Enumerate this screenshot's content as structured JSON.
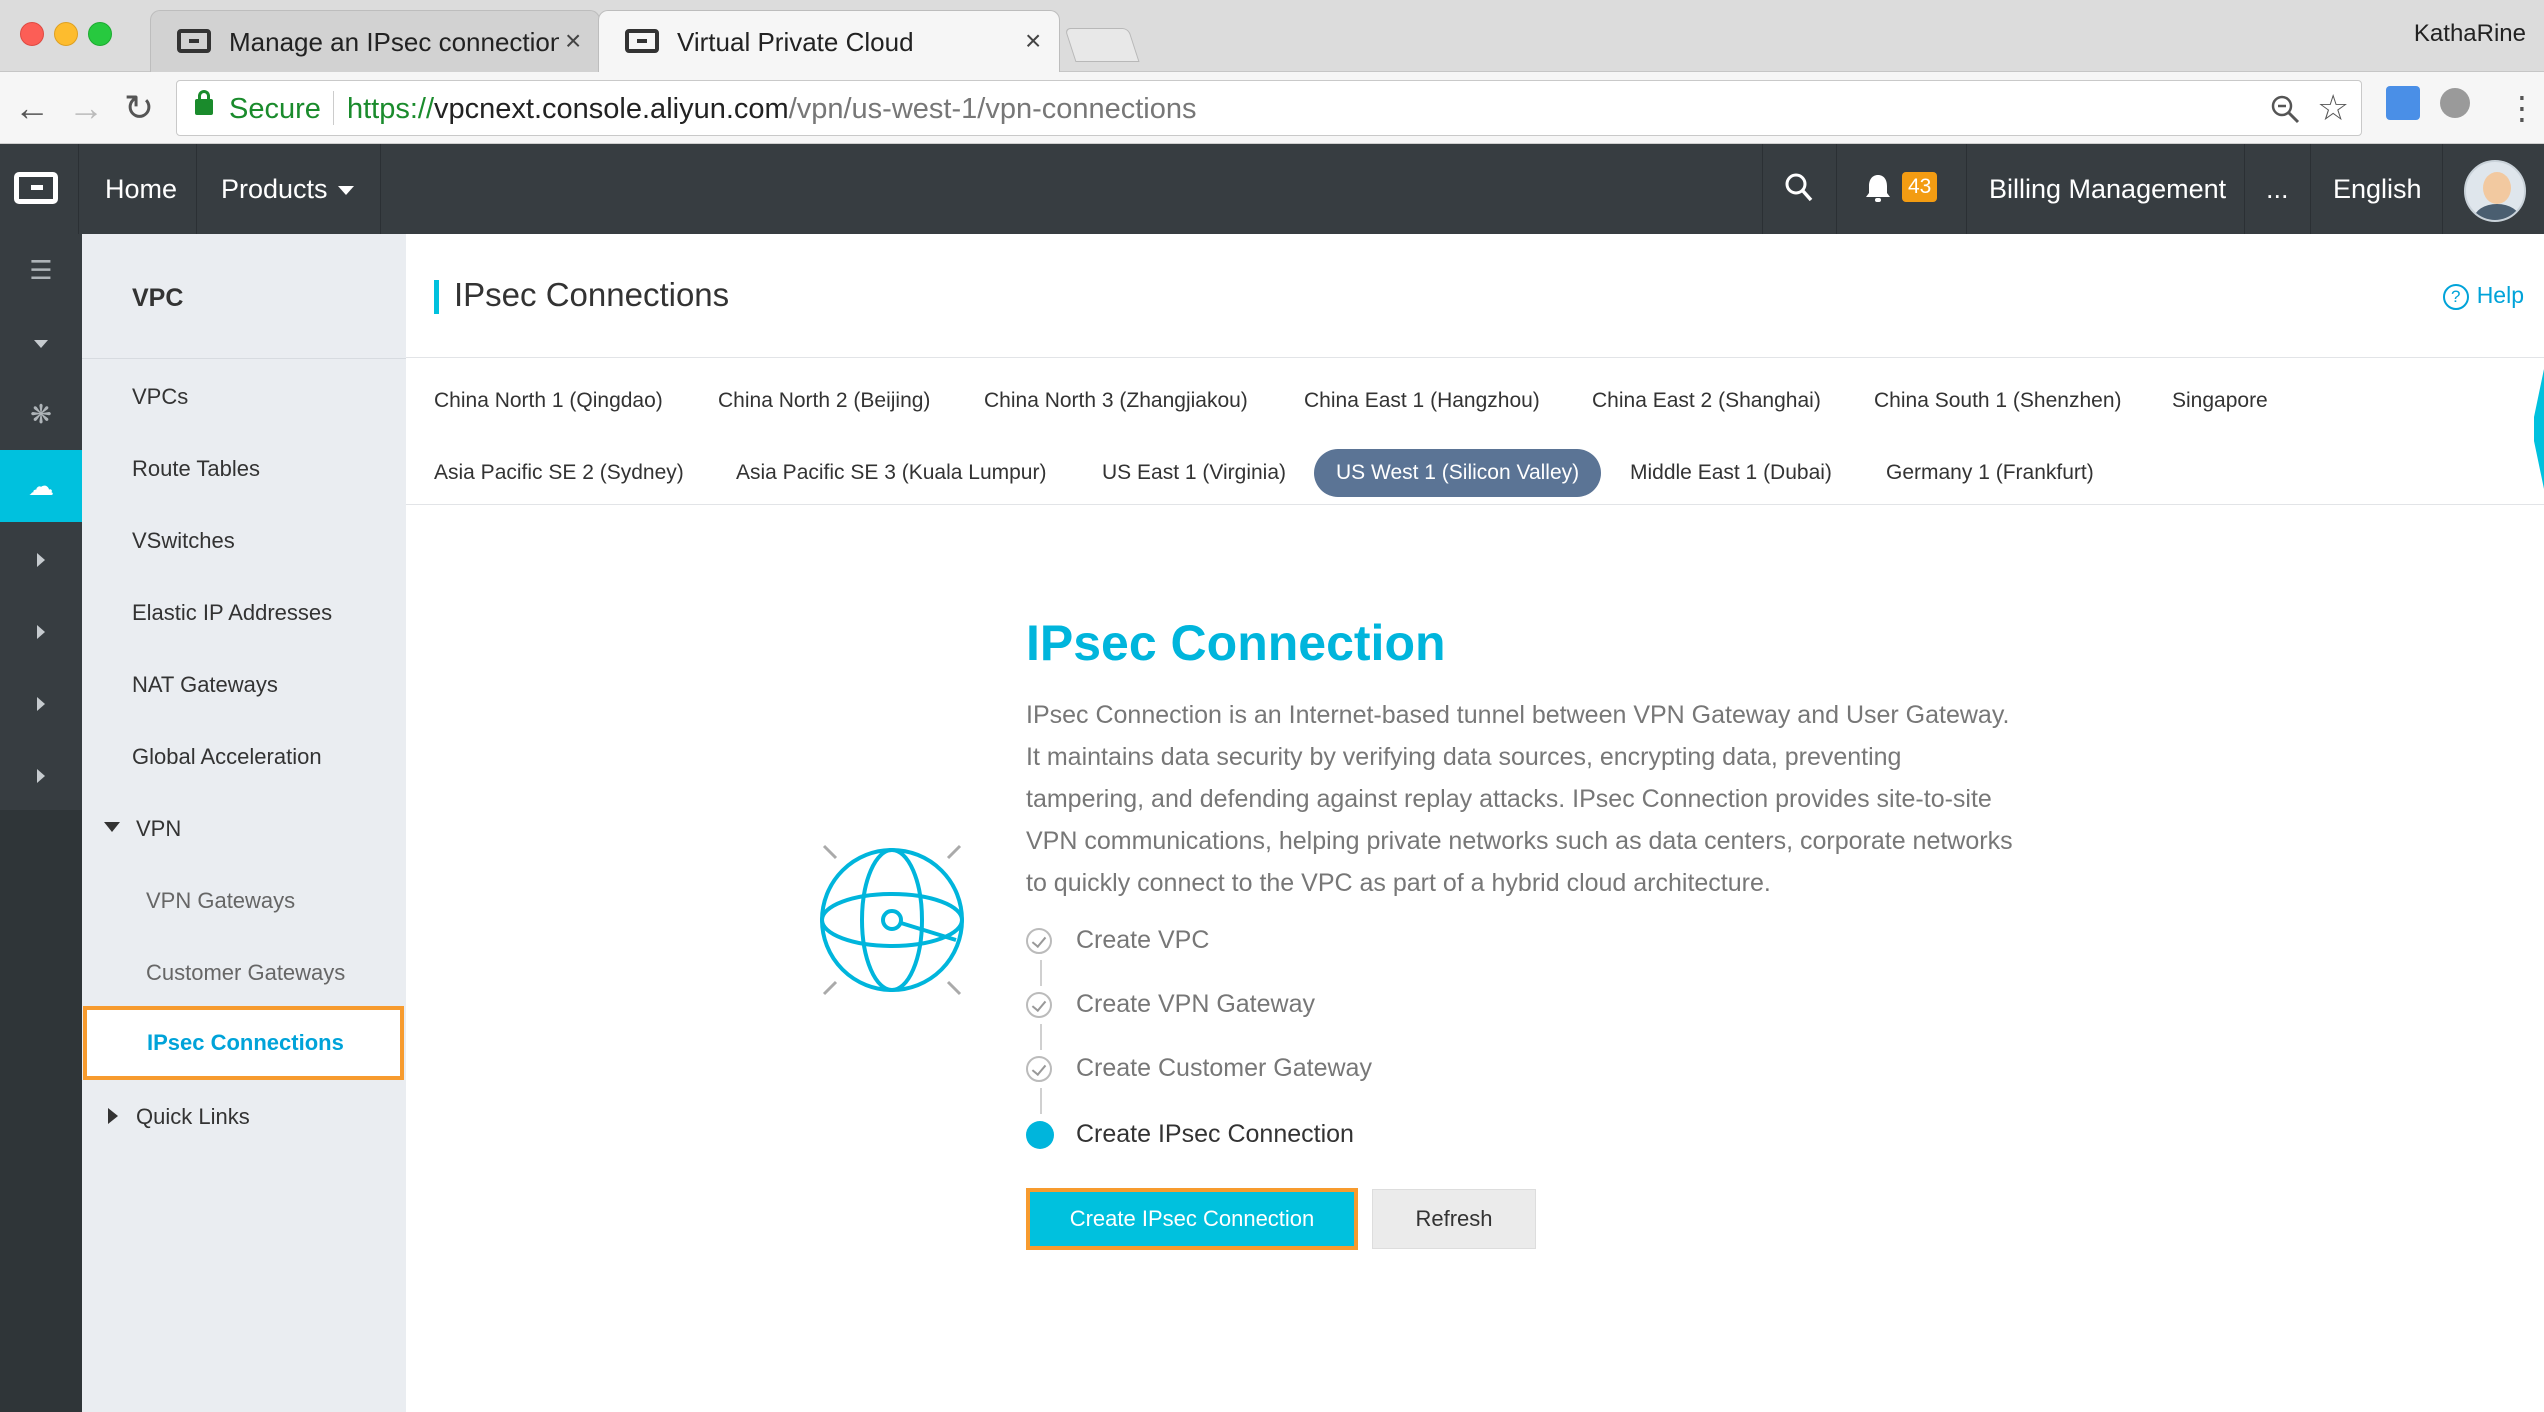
{
  "browser": {
    "tabs": [
      {
        "title": "Manage an IPsec connection -",
        "close": "×"
      },
      {
        "title": "Virtual Private Cloud",
        "close": "×"
      }
    ],
    "profile_name": "KathaRine",
    "secure_label": "Secure",
    "url": {
      "scheme": "https://",
      "host": "vpcnext.console.aliyun.com",
      "path": "/vpn/us-west-1/vpn-connections"
    }
  },
  "topnav": {
    "home": "Home",
    "products": "Products",
    "notification_count": "43",
    "billing": "Billing Management",
    "more": "...",
    "language": "English"
  },
  "sidebar": {
    "title": "VPC",
    "items": [
      "VPCs",
      "Route Tables",
      "VSwitches",
      "Elastic IP Addresses",
      "NAT Gateways",
      "Global Acceleration"
    ],
    "vpn_group": "VPN",
    "vpn_items": [
      "VPN Gateways",
      "Customer Gateways",
      "IPsec Connections"
    ],
    "quick_links": "Quick Links"
  },
  "page": {
    "title": "IPsec Connections",
    "help": "Help"
  },
  "regions": {
    "row1": [
      "China North 1 (Qingdao)",
      "China North 2 (Beijing)",
      "China North 3 (Zhangjiakou)",
      "China East 1 (Hangzhou)",
      "China East 2 (Shanghai)",
      "China South 1 (Shenzhen)",
      "Singapore"
    ],
    "row2": [
      "Asia Pacific SE 2 (Sydney)",
      "Asia Pacific SE 3 (Kuala Lumpur)",
      "US East 1 (Virginia)",
      "US West 1 (Silicon Valley)",
      "Middle East 1 (Dubai)",
      "Germany 1 (Frankfurt)"
    ],
    "selected": "US West 1 (Silicon Valley)"
  },
  "intro": {
    "title": "IPsec Connection",
    "description": "IPsec Connection is an Internet-based tunnel between VPN Gateway and User Gateway. It maintains data security by verifying data sources, encrypting data, preventing tampering, and defending against replay attacks. IPsec Connection provides site-to-site VPN communications, helping private networks such as data centers, corporate networks to quickly connect to the VPC as part of a hybrid cloud architecture.",
    "steps": [
      {
        "label": "Create VPC",
        "state": "done"
      },
      {
        "label": "Create VPN Gateway",
        "state": "done"
      },
      {
        "label": "Create Customer Gateway",
        "state": "done"
      },
      {
        "label": "Create IPsec Connection",
        "state": "current"
      }
    ],
    "primary_button": "Create IPsec Connection",
    "secondary_button": "Refresh"
  },
  "colors": {
    "accent": "#00c1de",
    "title_blue": "#00b5dc",
    "highlight_outline": "#f79b2e",
    "topnav_bg": "#373d41",
    "selected_region_bg": "#5b7495",
    "badge": "#f39c12"
  },
  "icons": [
    "back-arrow-icon",
    "forward-arrow-icon",
    "reload-icon",
    "lock-icon",
    "zoom-icon",
    "star-icon",
    "translate-icon",
    "extension-icon",
    "menu-dots-icon",
    "search-icon",
    "bell-icon",
    "menu-icon",
    "globe-connection-icon",
    "help-icon"
  ]
}
